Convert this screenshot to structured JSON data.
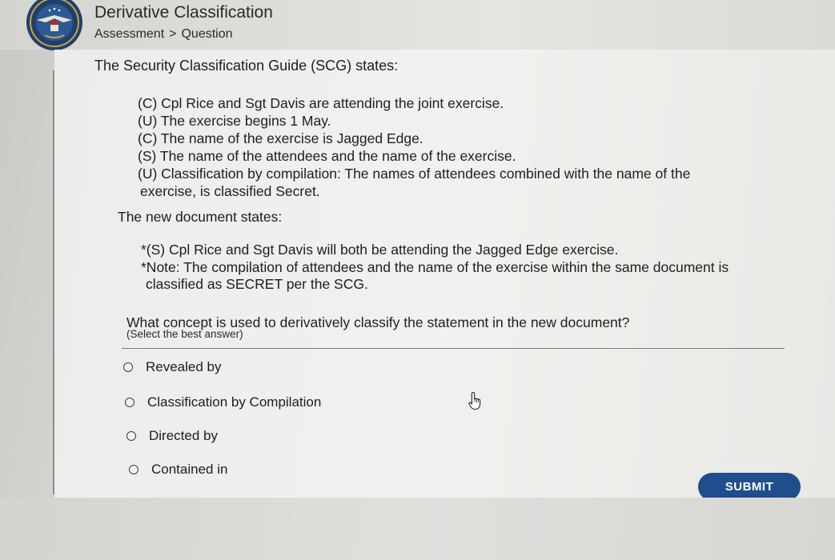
{
  "header": {
    "title": "Derivative Classification",
    "breadcrumb": {
      "root": "Assessment",
      "separator": ">",
      "current": "Question"
    }
  },
  "prompt": {
    "intro": "The Security Classification Guide (SCG) states:",
    "guide_lines": [
      "(C) Cpl Rice and Sgt Davis are attending the joint exercise.",
      "(U) The exercise begins 1 May.",
      "(C) The name of the exercise is Jagged Edge.",
      "(S) The name of the attendees and the name of the exercise.",
      "(U) Classification by compilation: The names of attendees combined with the name of the",
      "exercise, is classified Secret."
    ],
    "new_doc_heading": "The new document states:",
    "new_doc_lines": [
      "*(S) Cpl Rice and Sgt Davis will both be attending the Jagged Edge exercise.",
      "*Note:  The compilation of attendees and the name of the exercise within the same document is",
      "classified as SECRET per the SCG."
    ],
    "question": "What concept is used to derivatively classify the statement in the new document?",
    "hint": "(Select the best answer)"
  },
  "options": [
    {
      "label": "Revealed by"
    },
    {
      "label": "Classification by Compilation"
    },
    {
      "label": "Directed by"
    },
    {
      "label": "Contained in"
    }
  ],
  "actions": {
    "submit_label": "SUBMIT"
  },
  "colors": {
    "submit_bg": "#1f4e8c",
    "seal_blue": "#1f3f6e"
  },
  "icons": {
    "seal": "dod-seal-icon",
    "cursor": "hand-pointer-icon"
  }
}
